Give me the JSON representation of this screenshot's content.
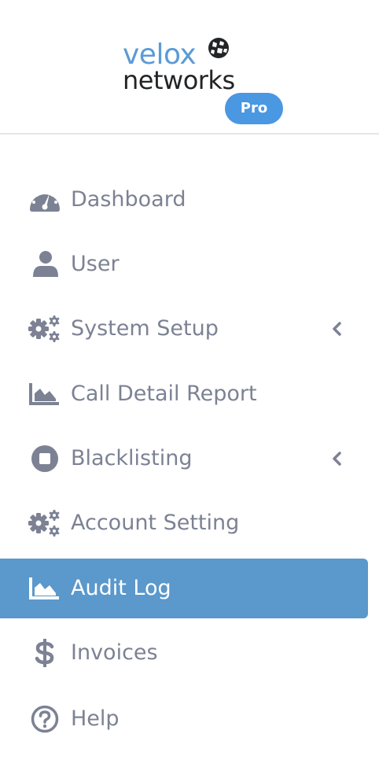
{
  "brand": {
    "name_top": "velox",
    "name_bottom": "networks",
    "badge": "Pro",
    "colors": {
      "velox": "#5b9bd5",
      "networks": "#222426",
      "badge": "#4a97e2"
    }
  },
  "menu": {
    "items": [
      {
        "label": "Dashboard",
        "icon": "tachometer-icon",
        "active": false,
        "has_submenu": false
      },
      {
        "label": "User",
        "icon": "user-icon",
        "active": false,
        "has_submenu": false
      },
      {
        "label": "System Setup",
        "icon": "cogs-icon",
        "active": false,
        "has_submenu": true
      },
      {
        "label": "Call Detail Report",
        "icon": "area-chart-icon",
        "active": false,
        "has_submenu": false
      },
      {
        "label": "Blacklisting",
        "icon": "stop-circle-icon",
        "active": false,
        "has_submenu": true
      },
      {
        "label": "Account Setting",
        "icon": "cogs-icon",
        "active": false,
        "has_submenu": false
      },
      {
        "label": "Audit Log",
        "icon": "area-chart-icon",
        "active": true,
        "has_submenu": false
      },
      {
        "label": "Invoices",
        "icon": "dollar-icon",
        "active": false,
        "has_submenu": false
      },
      {
        "label": "Help",
        "icon": "question-circle-icon",
        "active": false,
        "has_submenu": false
      }
    ],
    "colors": {
      "text": "#7c8294",
      "active_bg": "#5b98cb",
      "active_text": "#ffffff"
    }
  }
}
